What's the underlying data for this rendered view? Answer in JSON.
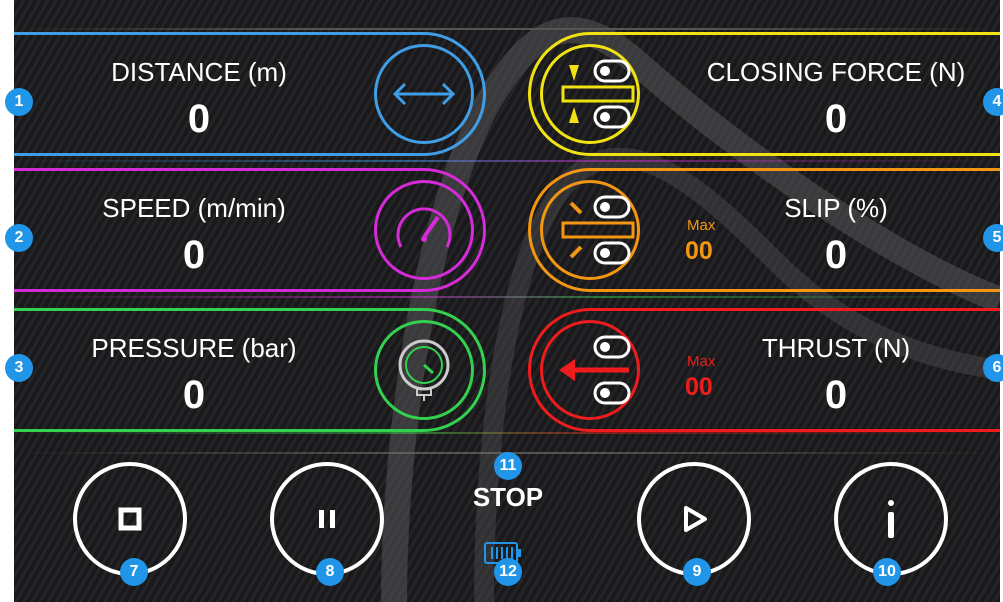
{
  "colors": {
    "distance": "#3f9ee6",
    "speed": "#d52bd8",
    "pressure": "#33d14f",
    "closing_force": "#f1e313",
    "slip": "#f39612",
    "thrust": "#ee1c1c",
    "badge": "#2196e8",
    "battery": "#2196e8"
  },
  "metrics": {
    "distance": {
      "label": "DISTANCE (m)",
      "value": "0",
      "icon": "double-arrow-icon",
      "badge": "1"
    },
    "speed": {
      "label": "SPEED (m/min)",
      "value": "0",
      "icon": "speedometer-icon",
      "badge": "2"
    },
    "pressure": {
      "label": "PRESSURE (bar)",
      "value": "0",
      "icon": "pressure-gauge-icon",
      "badge": "3"
    },
    "closing_force": {
      "label": "CLOSING FORCE (N)",
      "value": "0",
      "icon": "closing-force-icon",
      "badge": "4"
    },
    "slip": {
      "label": "SLIP (%)",
      "value": "0",
      "max_label": "Max",
      "max_value": "00",
      "icon": "slip-icon",
      "badge": "5"
    },
    "thrust": {
      "label": "THRUST (N)",
      "value": "0",
      "max_label": "Max",
      "max_value": "00",
      "icon": "thrust-icon",
      "badge": "6"
    }
  },
  "controls": {
    "stop": {
      "icon": "stop-icon",
      "badge": "7"
    },
    "pause": {
      "icon": "pause-icon",
      "badge": "8"
    },
    "play": {
      "icon": "play-icon",
      "badge": "9"
    },
    "info": {
      "icon": "info-icon",
      "badge": "10"
    }
  },
  "status": {
    "text": "STOP",
    "badge": "11"
  },
  "battery": {
    "icon": "battery-icon",
    "badge": "12"
  }
}
